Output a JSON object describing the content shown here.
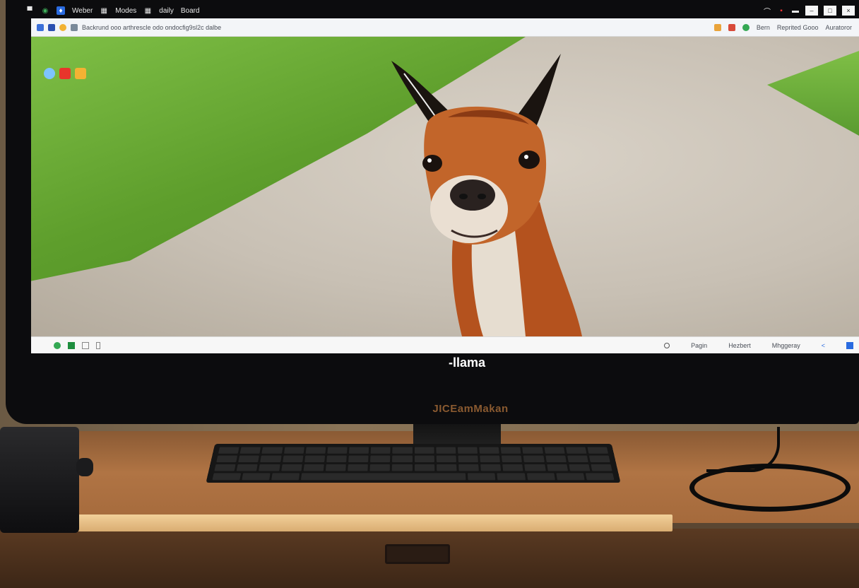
{
  "os_bar": {
    "items": [
      "Weber",
      "Modes",
      "daily",
      "Board"
    ]
  },
  "browser": {
    "address_text": "Backrund ooo arthrescle odo ondocfig9sl2c dalbe",
    "toolbar_right": [
      "Bern",
      "Reprited Gooo",
      "Auratoror"
    ]
  },
  "status_bar": {
    "items": [
      "Pagin",
      "Hezbert",
      "Mhggeray"
    ]
  },
  "monitor": {
    "caption": "-llama",
    "brand": "JICEamMakan"
  },
  "icons": {
    "address_left": [
      "shield-icon",
      "shield-icon",
      "chrome-icon",
      "info-icon"
    ],
    "favorites": [
      "edge-icon",
      "youtube-icon",
      "folder-icon"
    ],
    "status_left": [
      "chrome-icon",
      "sheets-icon",
      "image-icon",
      "file-icon"
    ]
  },
  "colors": {
    "grass": "#5e9e2c",
    "road": "#c8c0b4",
    "llama_fur": "#b4521e",
    "desk": "#b07444"
  }
}
